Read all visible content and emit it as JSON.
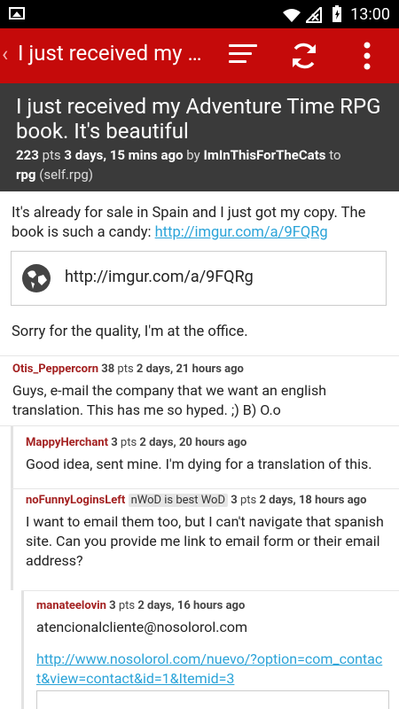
{
  "status": {
    "time": "13:00"
  },
  "toolbar": {
    "title": "I just received my A...",
    "back_icon": "back-arrow-icon"
  },
  "post": {
    "title": "I just received my Adventure Time RPG book. It's beautiful",
    "points": "223",
    "pts_label": "pts",
    "age": "3 days, 15 mins ago",
    "by_label": "by",
    "author": "ImInThisForTheCats",
    "to_label": "to",
    "subreddit": "rpg",
    "domain": "(self.rpg)",
    "body_text": "It's already for sale in Spain and I just got my copy. The book is such a candy:",
    "body_link": "http://imgur.com/a/9FQRg",
    "preview_url": "http://imgur.com/a/9FQRg",
    "body_text2": "Sorry for the quality, I'm at the office."
  },
  "comments": [
    {
      "author": "Otis_Peppercorn",
      "points": "38",
      "pts_label": "pts",
      "age": "2 days, 21 hours ago",
      "body": "Guys, e-mail the company that we want an english translation. This has me so hyped. ;) B) O.o"
    },
    {
      "author": "MappyHerchant",
      "points": "3",
      "pts_label": "pts",
      "age": "2 days, 20 hours ago",
      "body": "Good idea, sent mine. I'm dying for a translation of this."
    },
    {
      "author": "noFunnyLoginsLeft",
      "flair": "nWoD is best WoD",
      "points": "3",
      "pts_label": "pts",
      "age": "2 days, 18 hours ago",
      "body": "I want to email them too, but I can't navigate that spanish site. Can you provide me link to email form or their email address?"
    },
    {
      "author": "manateelovin",
      "points": "3",
      "pts_label": "pts",
      "age": "2 days, 16 hours ago",
      "body": "atencionalcliente@nosolorol.com",
      "link": "http://www.nosolorol.com/nuevo/?option=com_contact&view=contact&id=1&Itemid=3"
    }
  ]
}
